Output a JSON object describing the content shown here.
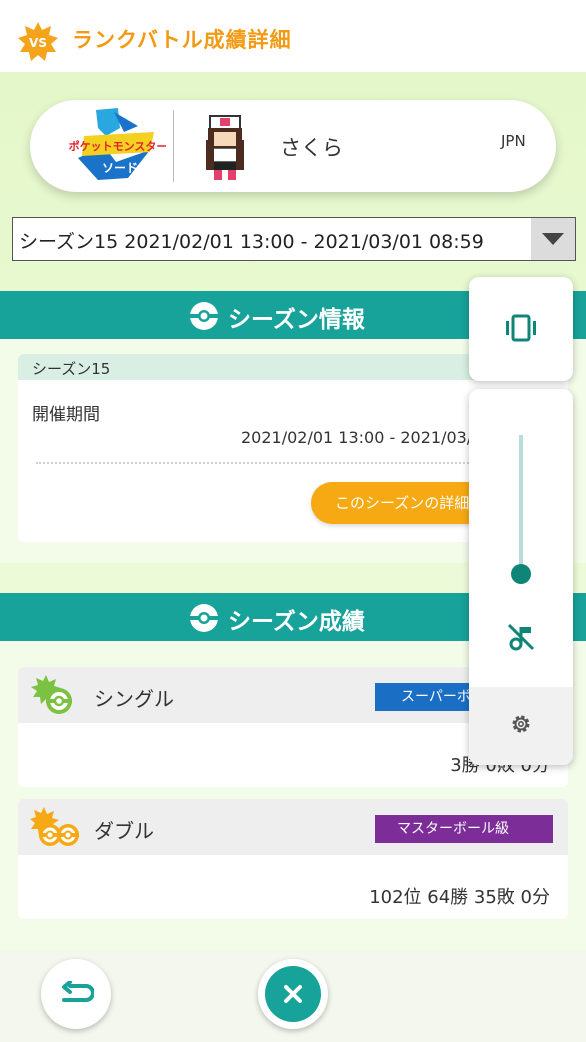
{
  "header": {
    "badge_text": "VS",
    "title": "ランクバトル成績詳細"
  },
  "profile": {
    "game_logo_line1": "ポケットモンスター",
    "game_logo_line2": "ソード",
    "player_name": "さくら",
    "region": "JPN"
  },
  "season_select": {
    "selected": "シーズン15 2021/02/01 13:00 - 2021/03/01 08:59"
  },
  "season_info": {
    "section_title": "シーズン情報",
    "card_title": "シーズン15",
    "period_label": "開催期間",
    "period_value": "2021/02/01 13:00 - 2021/03/01 08:59",
    "details_button": "このシーズンの詳細を見る"
  },
  "season_results": {
    "section_title": "シーズン成績",
    "rows": [
      {
        "mode": "シングル",
        "rank": "スーパーボール級",
        "rank_color": "#1a6fc4",
        "record": "3勝 0敗 0分"
      },
      {
        "mode": "ダブル",
        "rank": "マスターボール級",
        "rank_color": "#7c2d98",
        "record": "102位 64勝 35敗 0分"
      }
    ]
  },
  "colors": {
    "accent": "#17a29a",
    "header_title": "#f39a14",
    "button_orange": "#f6a913",
    "volume_thumb": "#0f8578"
  },
  "volume_overlay": {
    "mode_icon": "vibrate-icon",
    "level": 0.07,
    "mute_icon": "music-off-icon",
    "settings_icon": "gear-icon"
  },
  "footer": {
    "back_icon": "back-arrow-icon",
    "close_icon": "close-icon"
  }
}
